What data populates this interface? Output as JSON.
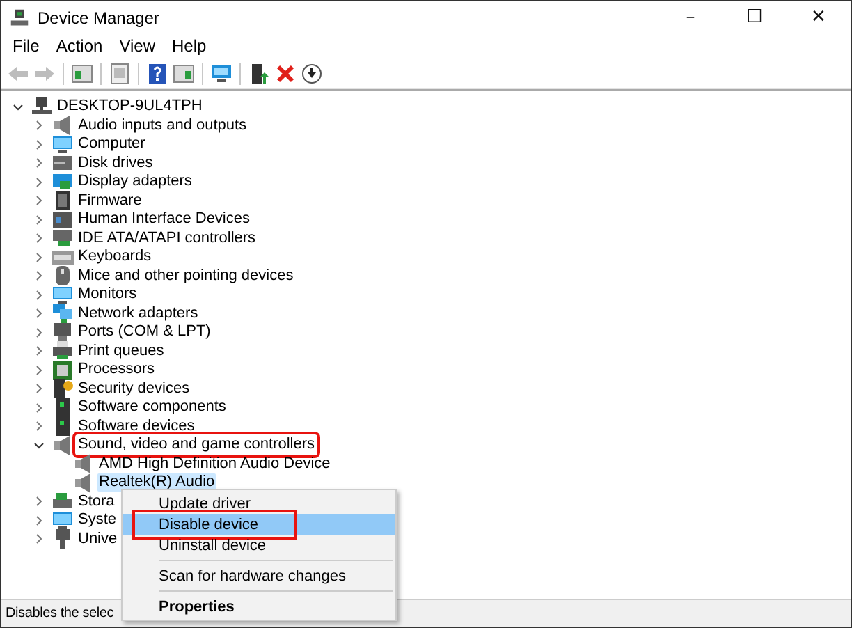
{
  "window": {
    "title": "Device Manager",
    "controls": [
      "–",
      "☐",
      "✕"
    ]
  },
  "menu_bar": [
    "File",
    "Action",
    "View",
    "Help"
  ],
  "toolbar": [
    {
      "kind": "back",
      "disabled": true
    },
    {
      "kind": "forward",
      "disabled": true
    },
    {
      "kind": "sep"
    },
    {
      "kind": "panel"
    },
    {
      "kind": "sep"
    },
    {
      "kind": "properties"
    },
    {
      "kind": "sep"
    },
    {
      "kind": "help"
    },
    {
      "kind": "panel2"
    },
    {
      "kind": "sep"
    },
    {
      "kind": "scan"
    },
    {
      "kind": "sep"
    },
    {
      "kind": "update"
    },
    {
      "kind": "remove"
    },
    {
      "kind": "download"
    }
  ],
  "tree": {
    "label": "DESKTOP-9UL4TPH",
    "kind": "computer",
    "expanded": true,
    "children": [
      {
        "label": "Audio inputs and outputs",
        "kind": "speaker",
        "expanded": false,
        "selected": false,
        "highlighted": false
      },
      {
        "label": "Computer",
        "kind": "monitor",
        "expanded": false,
        "selected": false,
        "highlighted": false
      },
      {
        "label": "Disk drives",
        "kind": "drive",
        "expanded": false,
        "selected": false,
        "highlighted": false
      },
      {
        "label": "Display adapters",
        "kind": "display",
        "expanded": false,
        "selected": false,
        "highlighted": false
      },
      {
        "label": "Firmware",
        "kind": "chip",
        "expanded": false,
        "selected": false,
        "highlighted": false
      },
      {
        "label": "Human Interface Devices",
        "kind": "hid",
        "expanded": false,
        "selected": false,
        "highlighted": false
      },
      {
        "label": "IDE ATA/ATAPI controllers",
        "kind": "card",
        "expanded": false,
        "selected": false,
        "highlighted": false
      },
      {
        "label": "Keyboards",
        "kind": "keyboard",
        "expanded": false,
        "selected": false,
        "highlighted": false
      },
      {
        "label": "Mice and other pointing devices",
        "kind": "mouse",
        "expanded": false,
        "selected": false,
        "highlighted": false
      },
      {
        "label": "Monitors",
        "kind": "monitor",
        "expanded": false,
        "selected": false,
        "highlighted": false
      },
      {
        "label": "Network adapters",
        "kind": "network",
        "expanded": false,
        "selected": false,
        "highlighted": false
      },
      {
        "label": "Ports (COM & LPT)",
        "kind": "port",
        "expanded": false,
        "selected": false,
        "highlighted": false
      },
      {
        "label": "Print queues",
        "kind": "printer",
        "expanded": false,
        "selected": false,
        "highlighted": false
      },
      {
        "label": "Processors",
        "kind": "processor",
        "expanded": false,
        "selected": false,
        "highlighted": false
      },
      {
        "label": "Security devices",
        "kind": "security",
        "expanded": false,
        "selected": false,
        "highlighted": false
      },
      {
        "label": "Software components",
        "kind": "software",
        "expanded": false,
        "selected": false,
        "highlighted": false
      },
      {
        "label": "Software devices",
        "kind": "software",
        "expanded": false,
        "selected": false,
        "highlighted": false
      },
      {
        "label": "Sound, video and game controllers",
        "kind": "speaker",
        "expanded": true,
        "selected": false,
        "highlighted": true,
        "children": [
          {
            "label": "AMD High Definition Audio Device",
            "kind": "speaker",
            "selected": false
          },
          {
            "label": "Realtek(R) Audio",
            "kind": "speaker",
            "selected": true
          }
        ]
      },
      {
        "label": "Stora",
        "kind": "storage",
        "expanded": false,
        "selected": false,
        "highlighted": false
      },
      {
        "label": "Syste",
        "kind": "monitor",
        "expanded": false,
        "selected": false,
        "highlighted": false
      },
      {
        "label": "Unive",
        "kind": "usb",
        "expanded": false,
        "selected": false,
        "highlighted": false
      }
    ]
  },
  "context_menu": [
    {
      "kind": "item",
      "label": "Update driver",
      "selected": false,
      "highlighted": false
    },
    {
      "kind": "item",
      "label": "Disable device",
      "selected": true,
      "highlighted": true
    },
    {
      "kind": "item",
      "label": "Uninstall device",
      "selected": false,
      "highlighted": false
    },
    {
      "kind": "separator"
    },
    {
      "kind": "item",
      "label": "Scan for hardware changes",
      "selected": false,
      "highlighted": false
    },
    {
      "kind": "separator"
    },
    {
      "kind": "default",
      "label": "Properties",
      "selected": false,
      "highlighted": false
    }
  ],
  "status_bar": "Disables the selec"
}
